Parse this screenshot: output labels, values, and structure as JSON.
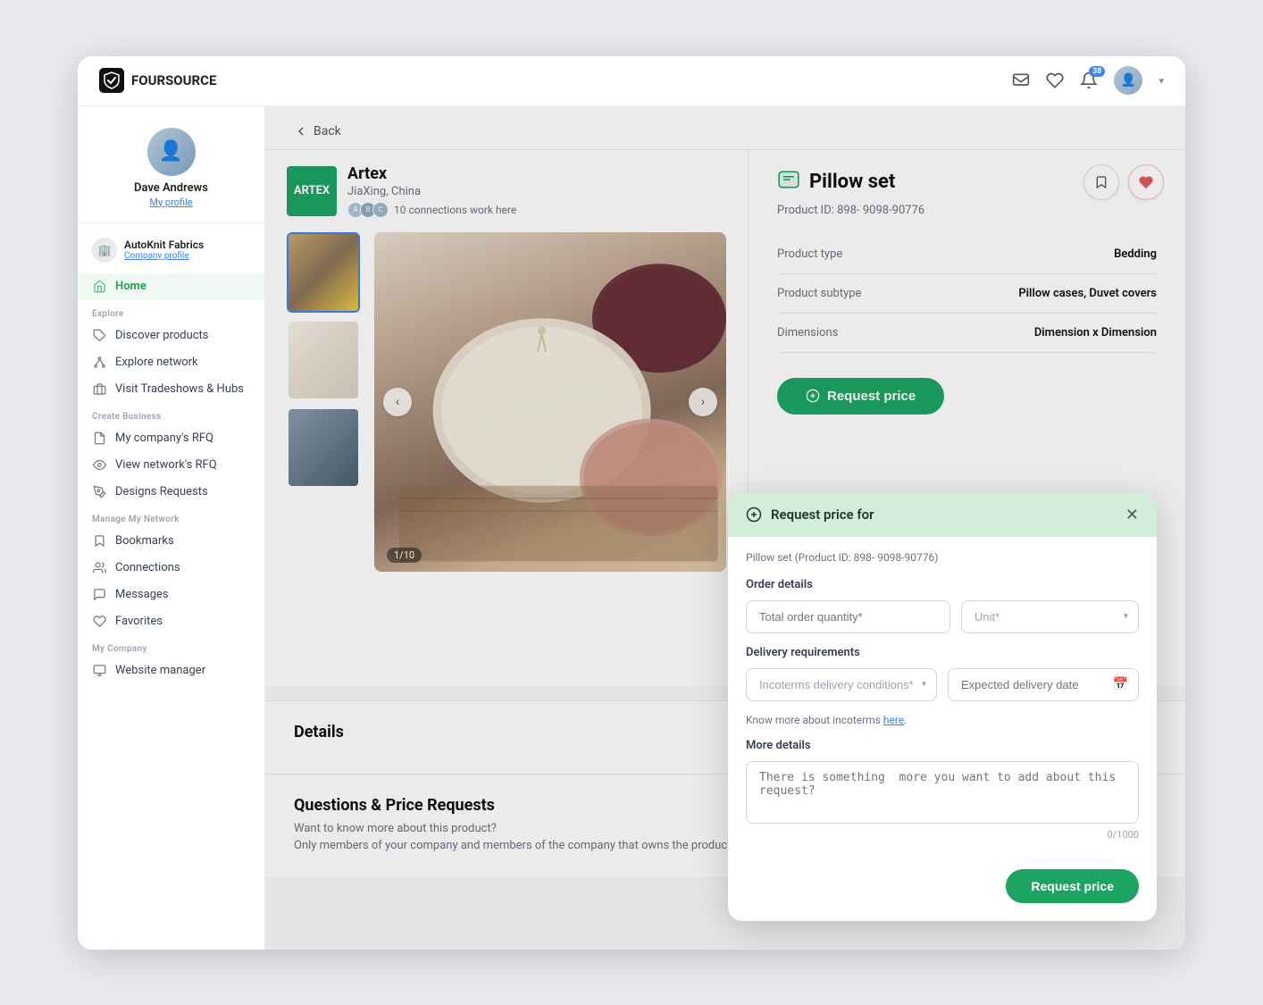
{
  "app": {
    "name": "FOURSOURCE"
  },
  "topnav": {
    "notification_count": "38",
    "icons": [
      "message-icon",
      "heart-icon",
      "bell-icon"
    ]
  },
  "sidebar": {
    "user": {
      "name": "Dave Andrews",
      "profile_link": "My profile"
    },
    "company": {
      "name": "AutoKnit Fabrics",
      "profile_link": "Company profile"
    },
    "nav_items": [
      {
        "id": "home",
        "label": "Home",
        "icon": "home-icon"
      },
      {
        "id": "discover-products",
        "label": "Discover products",
        "icon": "tag-icon",
        "section": "Explore"
      },
      {
        "id": "explore-network",
        "label": "Explore network",
        "icon": "network-icon"
      },
      {
        "id": "visit-tradeshows",
        "label": "Visit Tradeshows & Hubs",
        "icon": "building-icon"
      },
      {
        "id": "my-rfq",
        "label": "My company's RFQ",
        "icon": "doc-icon",
        "section": "Create Business"
      },
      {
        "id": "view-rfq",
        "label": "View network's RFQ",
        "icon": "eye-icon"
      },
      {
        "id": "designs-requests",
        "label": "Designs Requests",
        "icon": "design-icon"
      },
      {
        "id": "bookmarks",
        "label": "Bookmarks",
        "icon": "bookmark-icon",
        "section": "Manage my network"
      },
      {
        "id": "connections",
        "label": "Connections",
        "icon": "people-icon"
      },
      {
        "id": "messages",
        "label": "Messages",
        "icon": "message-icon"
      },
      {
        "id": "favorites",
        "label": "Favorites",
        "icon": "heart-icon"
      },
      {
        "id": "website-manager",
        "label": "Website manager",
        "icon": "monitor-icon",
        "section": "My company"
      }
    ]
  },
  "breadcrumb": {
    "back_label": "Back"
  },
  "vendor": {
    "name": "Artex",
    "logo_text": "ARTEX",
    "logo_bg": "#1da462",
    "location": "JiaXing, China",
    "connections_count": "10",
    "connections_text": "10 connections work here"
  },
  "product": {
    "title": "Pillow set",
    "product_id": "Product ID: 898- 9098-90776",
    "type_label": "Product type",
    "type_value": "Bedding",
    "subtype_label": "Product subtype",
    "subtype_value": "Pillow cases, Duvet covers",
    "dimensions_label": "Dimensions",
    "dimensions_value": "Dimension x Dimension",
    "request_price_btn": "Request price",
    "gallery_counter": "1/10"
  },
  "details_section": {
    "title": "Details"
  },
  "questions_section": {
    "title": "Questions & Price Requests",
    "subtitle": "Want to know more about this product?",
    "description": "Only members of your company and members of the company that owns the product will"
  },
  "modal": {
    "title": "Request price for",
    "product_ref": "Pillow set (Product ID: 898- 9098-90776)",
    "order_details_label": "Order details",
    "quantity_placeholder": "Total order quantity*",
    "unit_placeholder": "Unit*",
    "delivery_label": "Delivery requirements",
    "incoterms_placeholder": "Incoterms delivery conditions*",
    "delivery_date_placeholder": "Expected delivery date",
    "incoterms_note": "Know more about incoterms",
    "incoterms_link_text": "here",
    "more_details_label": "More details",
    "textarea_placeholder": "There is something  more you want to add about this request?",
    "char_count": "0/1000",
    "submit_btn": "Request price"
  }
}
